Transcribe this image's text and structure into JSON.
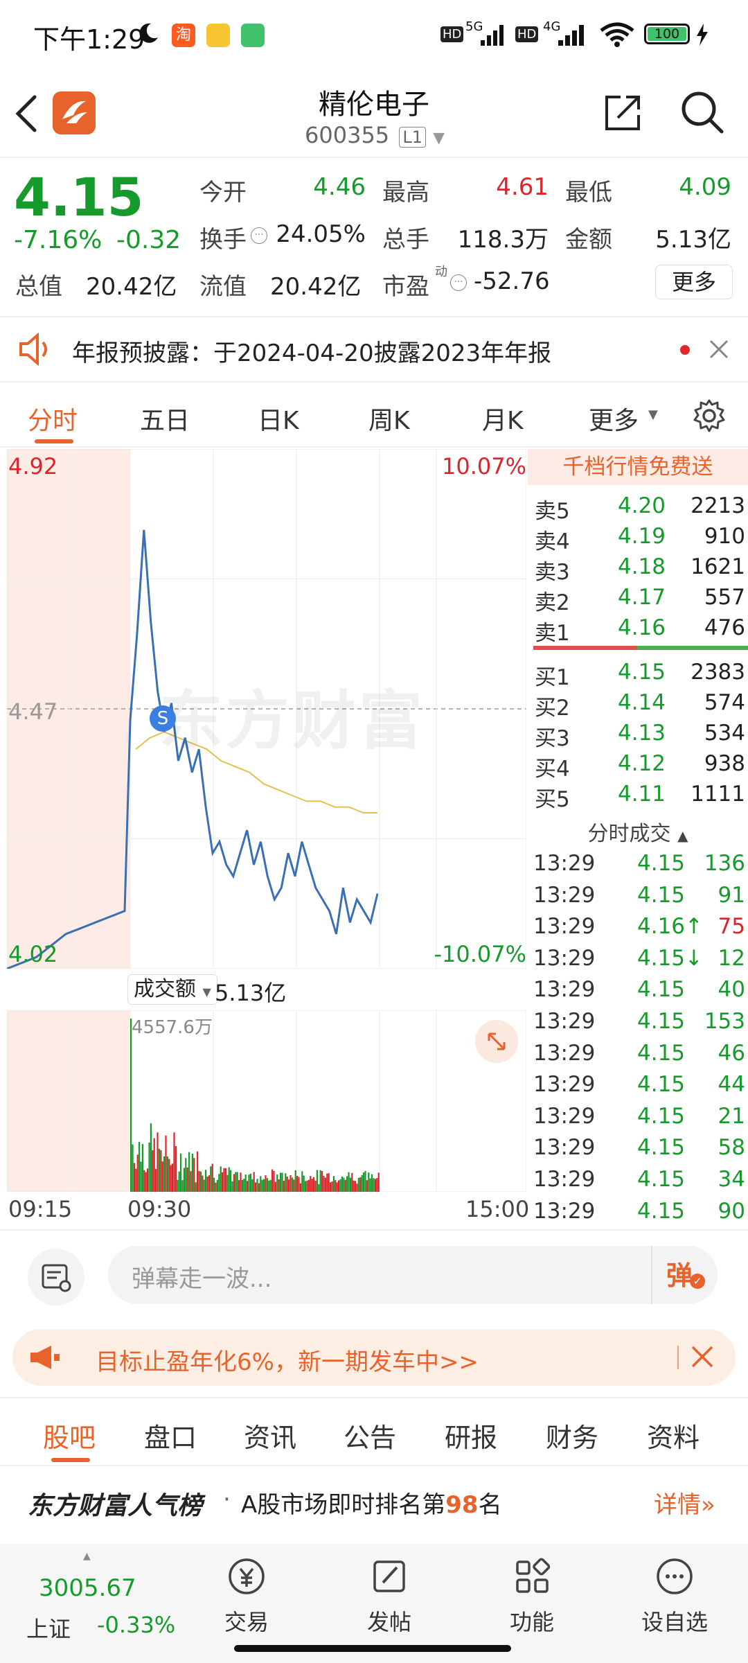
{
  "status_bar": {
    "time": "下午1:29",
    "network": "5G",
    "network2": "4G",
    "battery": "100"
  },
  "header": {
    "stock_name": "精伦电子",
    "stock_code": "600355",
    "level_badge": "L1",
    "logo_text": "东方财富"
  },
  "quote": {
    "price": "4.15",
    "change_pct": "-7.16%",
    "change": "-0.32",
    "open_label": "今开",
    "open": "4.46",
    "high_label": "最高",
    "high": "4.61",
    "low_label": "最低",
    "low": "4.09",
    "turnover_label": "换手",
    "turnover": "24.05%",
    "volume_label": "总手",
    "volume": "118.3万",
    "amount_label": "金额",
    "amount": "5.13亿",
    "mktcap_label": "总值",
    "mktcap": "20.42亿",
    "float_label": "流值",
    "float": "20.42亿",
    "pe_label": "市盈",
    "pe_sup": "动",
    "pe": "-52.76",
    "more_button": "更多"
  },
  "notice": {
    "text": "年报预披露：于2024-04-20披露2023年年报"
  },
  "chart_tabs": [
    "分时",
    "五日",
    "日K",
    "周K",
    "月K",
    "更多"
  ],
  "chart": {
    "y_top": "4.92",
    "y_mid": "4.47",
    "y_bottom": "4.02",
    "pct_top": "10.07%",
    "pct_bottom": "-10.07%",
    "marker": "S",
    "watermark": "东方财富",
    "volume_label": "成交额",
    "volume_total": "5.13亿",
    "volume_max": "4557.6万",
    "time_start": "09:15",
    "time_mid": "09:30",
    "time_end": "15:00"
  },
  "chart_data": {
    "type": "line",
    "ylim": [
      4.02,
      4.92
    ],
    "reference_price": 4.47,
    "series": [
      {
        "values": [
          4.02,
          4.03,
          4.04,
          4.06,
          4.08,
          4.09,
          4.1,
          4.11,
          4.12,
          4.45,
          4.6,
          4.78,
          4.62,
          4.5,
          4.43,
          4.48,
          4.38,
          4.42,
          4.36,
          4.4,
          4.3,
          4.22,
          4.24,
          4.2,
          4.18,
          4.22,
          4.26,
          4.2,
          4.24,
          4.18,
          4.14,
          4.16,
          4.22,
          4.18,
          4.24,
          4.2,
          4.16,
          4.14,
          4.12,
          4.08,
          4.16,
          4.1,
          4.14,
          4.12,
          4.1,
          4.15
        ]
      },
      {
        "values": [
          4.4,
          4.42,
          4.43,
          4.42,
          4.41,
          4.4,
          4.38,
          4.37,
          4.36,
          4.34,
          4.33,
          4.32,
          4.31,
          4.31,
          4.3,
          4.3,
          4.29,
          4.29
        ]
      }
    ]
  },
  "orderbook": {
    "promo": "千档行情免费送",
    "asks": [
      {
        "label": "卖5",
        "price": "4.20",
        "vol": "2213"
      },
      {
        "label": "卖4",
        "price": "4.19",
        "vol": "910"
      },
      {
        "label": "卖3",
        "price": "4.18",
        "vol": "1621"
      },
      {
        "label": "卖2",
        "price": "4.17",
        "vol": "557"
      },
      {
        "label": "卖1",
        "price": "4.16",
        "vol": "476"
      }
    ],
    "bids": [
      {
        "label": "买1",
        "price": "4.15",
        "vol": "2383"
      },
      {
        "label": "买2",
        "price": "4.14",
        "vol": "574"
      },
      {
        "label": "买3",
        "price": "4.13",
        "vol": "534"
      },
      {
        "label": "买4",
        "price": "4.12",
        "vol": "938"
      },
      {
        "label": "买5",
        "price": "4.11",
        "vol": "1111"
      }
    ],
    "trades_title": "分时成交",
    "trades": [
      {
        "time": "13:29",
        "price": "4.15",
        "vol": "136",
        "dir": "green"
      },
      {
        "time": "13:29",
        "price": "4.15",
        "vol": "91",
        "dir": "green"
      },
      {
        "time": "13:29",
        "price": "4.16↑",
        "vol": "75",
        "dir": "red"
      },
      {
        "time": "13:29",
        "price": "4.15↓",
        "vol": "12",
        "dir": "green"
      },
      {
        "time": "13:29",
        "price": "4.15",
        "vol": "40",
        "dir": "green"
      },
      {
        "time": "13:29",
        "price": "4.15",
        "vol": "153",
        "dir": "green"
      },
      {
        "time": "13:29",
        "price": "4.15",
        "vol": "46",
        "dir": "green"
      },
      {
        "time": "13:29",
        "price": "4.15",
        "vol": "44",
        "dir": "green"
      },
      {
        "time": "13:29",
        "price": "4.15",
        "vol": "21",
        "dir": "green"
      },
      {
        "time": "13:29",
        "price": "4.15",
        "vol": "58",
        "dir": "green"
      },
      {
        "time": "13:29",
        "price": "4.15",
        "vol": "34",
        "dir": "green"
      },
      {
        "time": "13:29",
        "price": "4.15",
        "vol": "90",
        "dir": "green"
      }
    ]
  },
  "comment": {
    "placeholder": "弹幕走一波...",
    "danmu_button": "弹"
  },
  "promo": {
    "text": "目标止盈年化6%，新一期发车中>>"
  },
  "detail_tabs": [
    "股吧",
    "盘口",
    "资讯",
    "公告",
    "研报",
    "财务",
    "资料"
  ],
  "rank": {
    "brand": "东方财富人气榜",
    "dot": "·",
    "text_before": "A股市场即时排名第",
    "rank_number": "98",
    "text_after": "名",
    "detail": "详情"
  },
  "bottom_nav": {
    "index_value": "3005.67",
    "index_name": "上证",
    "index_change": "-0.33%",
    "trade": "交易",
    "post": "发帖",
    "functions": "功能",
    "watchlist": "设自选"
  },
  "colors": {
    "up": "#d9262b",
    "down": "#169a2b",
    "accent": "#e8632b",
    "price_line": "#3a6fb5",
    "avg_line": "#e6c04a"
  }
}
